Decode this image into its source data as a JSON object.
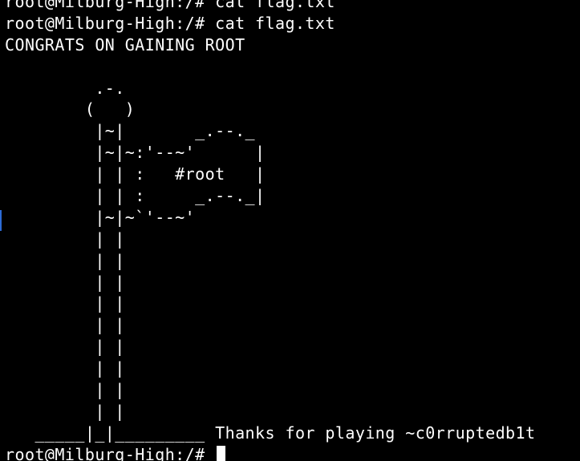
{
  "terminal": {
    "lines": [
      "root@Milburg-High:/# cat flag.txt",
      "root@Milburg-High:/# cat flag.txt",
      "CONGRATS ON GAINING ROOT",
      "",
      "         .-.",
      "        (   )",
      "         |~|       _.--._",
      "         |~|~:'--~'      |",
      "         | | :   #root   |",
      "         | | :     _.--._|",
      "         |~|~`'--~'",
      "         | |",
      "         | |",
      "         | |",
      "         | |",
      "         | |",
      "         | |",
      "         | |",
      "         | |",
      "         | |",
      "   _____|_|_________ Thanks for playing ~c0rruptedb1t"
    ],
    "prompt": "root@Milburg-High:/# ",
    "colors": {
      "background": "#000000",
      "foreground": "#ffffff",
      "edge_marker": "#2d6bd6"
    }
  }
}
